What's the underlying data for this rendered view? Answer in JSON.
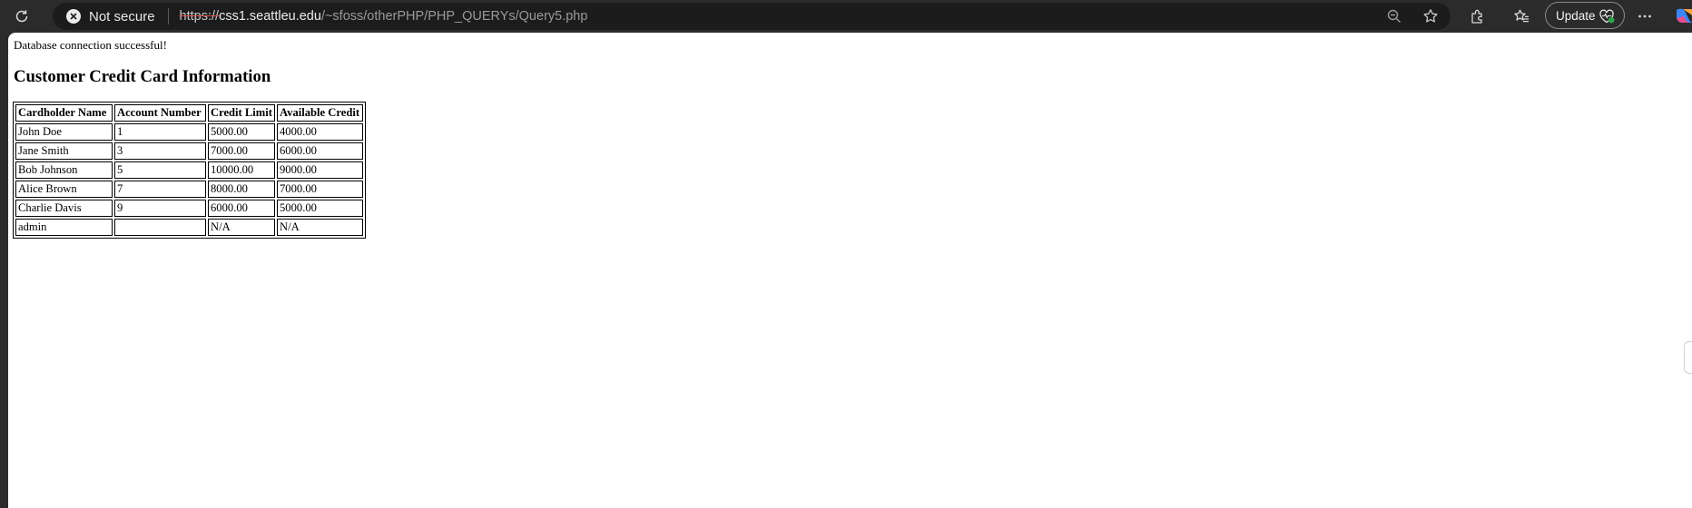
{
  "browser": {
    "security_label": "Not secure",
    "url": {
      "scheme": "https://",
      "host": "css1.seattleu.edu",
      "path": "/~sfoss/otherPHP/PHP_QUERYs/Query5.php"
    },
    "update_label": "Update",
    "icons": [
      "refresh-icon",
      "not-secure-icon",
      "zoom-out-icon",
      "favorite-star-icon",
      "extensions-icon",
      "favorites-icon",
      "heart-pulse-icon",
      "more-icon",
      "copilot-icon"
    ]
  },
  "page": {
    "status_message": "Database connection successful!",
    "heading": "Customer Credit Card Information",
    "table": {
      "headers": [
        "Cardholder Name",
        "Account Number",
        "Credit Limit",
        "Available Credit"
      ],
      "rows": [
        [
          "John Doe",
          "1",
          "5000.00",
          "4000.00"
        ],
        [
          "Jane Smith",
          "3",
          "7000.00",
          "6000.00"
        ],
        [
          "Bob Johnson",
          "5",
          "10000.00",
          "9000.00"
        ],
        [
          "Alice Brown",
          "7",
          "8000.00",
          "7000.00"
        ],
        [
          "Charlie Davis",
          "9",
          "6000.00",
          "5000.00"
        ],
        [
          "admin",
          "",
          "N/A",
          "N/A"
        ]
      ]
    }
  },
  "colors": {
    "chrome_bg": "#2b2b2b",
    "addressbar_bg": "#1c1c1c",
    "page_bg": "#ffffff",
    "insecure_strike": "#e05050"
  }
}
